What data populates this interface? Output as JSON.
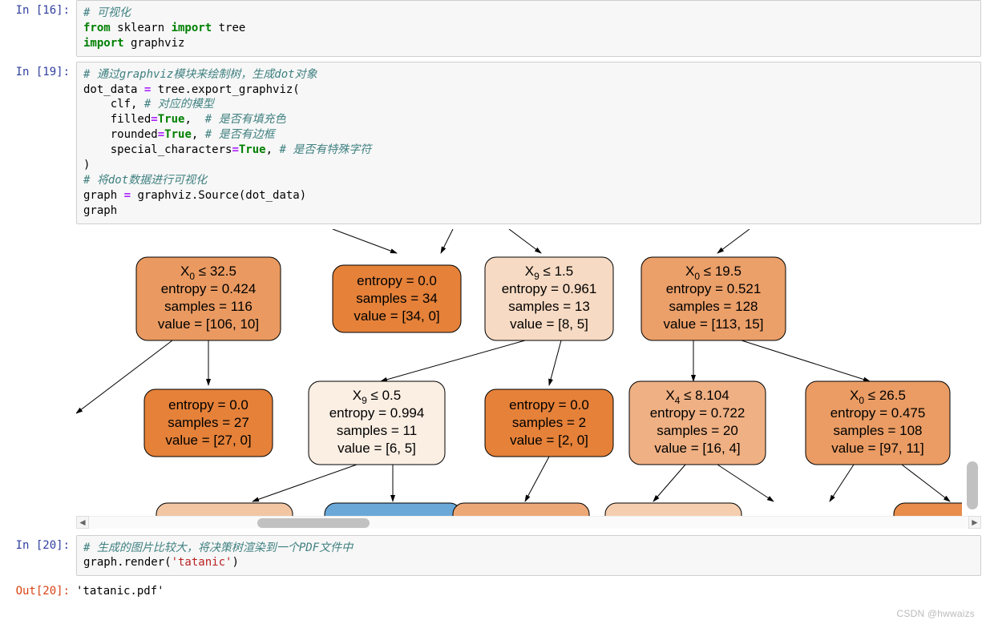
{
  "cells": {
    "c16": {
      "prompt": "In [16]:"
    },
    "c19": {
      "prompt": "In [19]:"
    },
    "c20": {
      "prompt": "In [20]:"
    },
    "o20": {
      "prompt": "Out[20]:",
      "text": "'tatanic.pdf'"
    }
  },
  "code16": {
    "comment1": "# 可视化",
    "line2_from": "from",
    "line2_mod": " sklearn ",
    "line2_import": "import",
    "line2_tree": " tree",
    "line3_import": "import",
    "line3_mod": " graphviz"
  },
  "code19": {
    "comment1": "# 通过graphviz模块来绘制树，生成dot对象",
    "l2a": "dot_data ",
    "l2op": "=",
    "l2b": " tree.export_graphviz(",
    "l3a": "    clf, ",
    "l3c": "# 对应的模型",
    "l4a": "    filled",
    "l4op": "=",
    "l4kw": "True",
    "l4p": ",  ",
    "l4c": "# 是否有填充色",
    "l5a": "    rounded",
    "l5op": "=",
    "l5kw": "True",
    "l5p": ", ",
    "l5c": "# 是否有边框",
    "l6a": "    special_characters",
    "l6op": "=",
    "l6kw": "True",
    "l6p": ", ",
    "l6c": "# 是否有特殊字符",
    "l7": ")",
    "l8c": "# 将dot数据进行可视化",
    "l9a": "graph ",
    "l9op": "=",
    "l9b": " graphviz.Source(dot_data)",
    "l10": "graph"
  },
  "code20": {
    "comment1": "# 生成的图片比较大，将决策树渲染到一个PDF文件中",
    "l2a": "graph.render(",
    "l2s": "'tatanic'",
    "l2b": ")"
  },
  "tree_nodes": {
    "r1n1": {
      "l1a": "X",
      "l1sub": "0",
      "l1b": " ≤ 32.5",
      "l2": "entropy = 0.424",
      "l3": "samples = 116",
      "l4": "value = [106, 10]",
      "fill": "#ea9a61"
    },
    "r1n2": {
      "l2": "entropy = 0.0",
      "l3": "samples = 34",
      "l4": "value = [34, 0]",
      "fill": "#e58139"
    },
    "r1n3": {
      "l1a": "X",
      "l1sub": "9",
      "l1b": " ≤ 1.5",
      "l2": "entropy = 0.961",
      "l3": "samples = 13",
      "l4": "value = [8, 5]",
      "fill": "#f7dac3"
    },
    "r1n4": {
      "l1a": "X",
      "l1sub": "0",
      "l1b": " ≤ 19.5",
      "l2": "entropy = 0.521",
      "l3": "samples = 128",
      "l4": "value = [113, 15]",
      "fill": "#eb9f69"
    },
    "r2n1": {
      "l2": "entropy = 0.0",
      "l3": "samples = 27",
      "l4": "value = [27, 0]",
      "fill": "#e58139"
    },
    "r2n2": {
      "l1a": "X",
      "l1sub": "9",
      "l1b": " ≤ 0.5",
      "l2": "entropy = 0.994",
      "l3": "samples = 11",
      "l4": "value = [6, 5]",
      "fill": "#fbeee3"
    },
    "r2n3": {
      "l2": "entropy = 0.0",
      "l3": "samples = 2",
      "l4": "value = [2, 0]",
      "fill": "#e58139"
    },
    "r2n4": {
      "l1a": "X",
      "l1sub": "4",
      "l1b": " ≤ 8.104",
      "l2": "entropy = 0.722",
      "l3": "samples = 20",
      "l4": "value = [16, 4]",
      "fill": "#efb083"
    },
    "r2n5": {
      "l1a": "X",
      "l1sub": "0",
      "l1b": " ≤ 26.5",
      "l2": "entropy = 0.475",
      "l3": "samples = 108",
      "l4": "value = [97, 11]",
      "fill": "#ea9c64"
    },
    "r3n2_fill": "#6aa8d8",
    "r3n1_fill": "#f3c6a3",
    "r3n3_fill": "#eda877",
    "r3n4_fill": "#f5ceaf",
    "r3n5_fill": "#e88d4b"
  },
  "watermark": "CSDN @hwwaizs",
  "chart_data": {
    "type": "table",
    "title": "Decision tree nodes (graphviz output)",
    "nodes": [
      {
        "id": "A",
        "row": 1,
        "split": "X0 ≤ 32.5",
        "entropy": 0.424,
        "samples": 116,
        "value": [
          106,
          10
        ]
      },
      {
        "id": "B",
        "row": 1,
        "split": null,
        "entropy": 0.0,
        "samples": 34,
        "value": [
          34,
          0
        ]
      },
      {
        "id": "C",
        "row": 1,
        "split": "X9 ≤ 1.5",
        "entropy": 0.961,
        "samples": 13,
        "value": [
          8,
          5
        ]
      },
      {
        "id": "D",
        "row": 1,
        "split": "X0 ≤ 19.5",
        "entropy": 0.521,
        "samples": 128,
        "value": [
          113,
          15
        ]
      },
      {
        "id": "E",
        "row": 2,
        "split": null,
        "entropy": 0.0,
        "samples": 27,
        "value": [
          27,
          0
        ]
      },
      {
        "id": "F",
        "row": 2,
        "split": "X9 ≤ 0.5",
        "entropy": 0.994,
        "samples": 11,
        "value": [
          6,
          5
        ]
      },
      {
        "id": "G",
        "row": 2,
        "split": null,
        "entropy": 0.0,
        "samples": 2,
        "value": [
          2,
          0
        ]
      },
      {
        "id": "H",
        "row": 2,
        "split": "X4 ≤ 8.104",
        "entropy": 0.722,
        "samples": 20,
        "value": [
          16,
          4
        ]
      },
      {
        "id": "I",
        "row": 2,
        "split": "X0 ≤ 26.5",
        "entropy": 0.475,
        "samples": 108,
        "value": [
          97,
          11
        ]
      }
    ],
    "edges": [
      [
        "A",
        "E"
      ],
      [
        "C",
        "F"
      ],
      [
        "C",
        "G"
      ],
      [
        "D",
        "H"
      ],
      [
        "D",
        "I"
      ],
      [
        "F",
        "r3a"
      ],
      [
        "F",
        "r3b"
      ],
      [
        "G",
        "r3c"
      ],
      [
        "H",
        "r3d"
      ],
      [
        "H",
        "r3e"
      ],
      [
        "I",
        "r3f"
      ],
      [
        "I",
        "r3g"
      ]
    ]
  }
}
